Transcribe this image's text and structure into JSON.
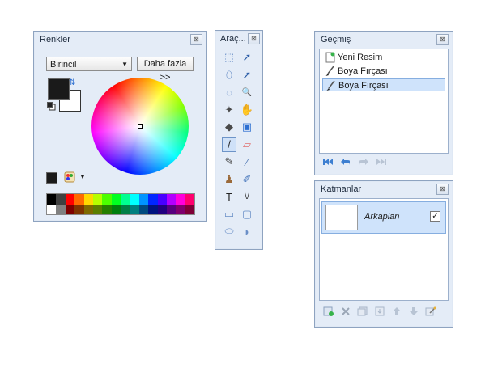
{
  "colors_window": {
    "title": "Renkler",
    "close_glyph": "⊠",
    "mode_select": "Birincil",
    "more_button": "Daha fazla >>",
    "primary_color": "#1a1a1a",
    "secondary_color": "#ffffff",
    "palette": [
      "#000000",
      "#404040",
      "#ff0000",
      "#ff6a00",
      "#ffd800",
      "#b6ff00",
      "#4cff00",
      "#00ff21",
      "#00ff90",
      "#00ffff",
      "#0094ff",
      "#0026ff",
      "#4800ff",
      "#b200ff",
      "#ff00dc",
      "#ff006e",
      "#ffffff",
      "#808080",
      "#7f0000",
      "#7f3300",
      "#7f6a00",
      "#5b7f00",
      "#267f00",
      "#007f0e",
      "#007f46",
      "#007f7f",
      "#004a7f",
      "#00137f",
      "#21007f",
      "#57007f",
      "#7f006e",
      "#7f0037"
    ]
  },
  "tools_window": {
    "title": "Araç...",
    "close_glyph": "⊠",
    "tools": [
      {
        "name": "rectangle-select-tool-icon",
        "glyph": "⬚"
      },
      {
        "name": "move-selected-pixels-icon",
        "glyph": "➚"
      },
      {
        "name": "lasso-select-icon",
        "glyph": "⬯"
      },
      {
        "name": "move-selection-icon",
        "glyph": "➚"
      },
      {
        "name": "ellipse-select-icon",
        "glyph": "◌"
      },
      {
        "name": "zoom-icon",
        "glyph": "🔍"
      },
      {
        "name": "magic-wand-icon",
        "glyph": "✦"
      },
      {
        "name": "pan-hand-icon",
        "glyph": "✋"
      },
      {
        "name": "paint-bucket-icon",
        "glyph": "◆"
      },
      {
        "name": "gradient-icon",
        "glyph": "▣"
      },
      {
        "name": "paintbrush-icon",
        "glyph": "/"
      },
      {
        "name": "eraser-icon",
        "glyph": "▱"
      },
      {
        "name": "pencil-icon",
        "glyph": "✎"
      },
      {
        "name": "color-picker-icon",
        "glyph": "⁄"
      },
      {
        "name": "clone-stamp-icon",
        "glyph": "♟"
      },
      {
        "name": "recolor-icon",
        "glyph": "✐"
      },
      {
        "name": "text-icon",
        "glyph": "T"
      },
      {
        "name": "line-curve-icon",
        "glyph": "\\/"
      },
      {
        "name": "rectangle-shape-icon",
        "glyph": "▭"
      },
      {
        "name": "rounded-rectangle-icon",
        "glyph": "▢"
      },
      {
        "name": "ellipse-shape-icon",
        "glyph": "⬭"
      },
      {
        "name": "freeform-shape-icon",
        "glyph": "◗"
      }
    ]
  },
  "history_window": {
    "title": "Geçmiş",
    "close_glyph": "⊠",
    "items": [
      {
        "label": "Yeni Resim",
        "icon": "new-image-icon"
      },
      {
        "label": "Boya Fırçası",
        "icon": "paintbrush-icon"
      },
      {
        "label": "Boya Fırçası",
        "icon": "paintbrush-icon"
      }
    ],
    "buttons": [
      "rewind-icon",
      "undo-icon",
      "redo-icon",
      "fast-forward-icon"
    ]
  },
  "layers_window": {
    "title": "Katmanlar",
    "close_glyph": "⊠",
    "layer_name": "Arkaplan",
    "layer_visible_check": "✓",
    "buttons": [
      "add-layer-icon",
      "delete-layer-icon",
      "duplicate-layer-icon",
      "merge-layer-down-icon",
      "move-layer-up-icon",
      "move-layer-down-icon",
      "layer-properties-icon"
    ]
  }
}
